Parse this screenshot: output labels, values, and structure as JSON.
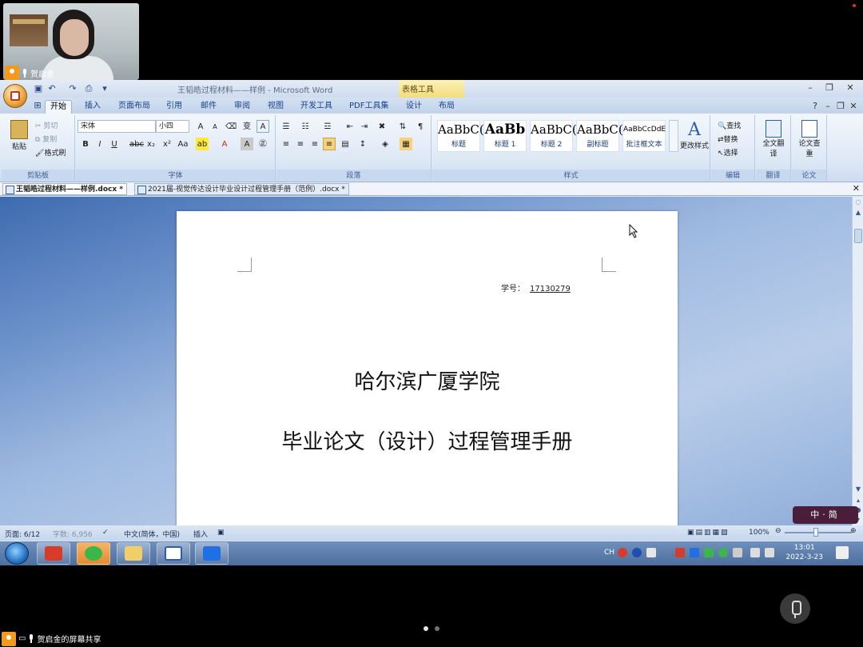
{
  "meeting": {
    "participant_name": "贺启金",
    "share_label": "贺启金的屏幕共享"
  },
  "window": {
    "title": "王韬皓过程材料——样例 - Microsoft Word",
    "context_tab": "表格工具"
  },
  "ribbon_tabs": [
    "开始",
    "插入",
    "页面布局",
    "引用",
    "邮件",
    "审阅",
    "视图",
    "开发工具",
    "PDF工具集",
    "设计",
    "布局"
  ],
  "ribbon": {
    "clipboard": {
      "paste": "粘贴",
      "cut": "剪切",
      "copy": "复制",
      "format_painter": "格式刷",
      "label": "剪贴板"
    },
    "font": {
      "name": "宋体",
      "size": "小四",
      "label": "字体"
    },
    "paragraph": {
      "label": "段落"
    },
    "styles": {
      "tiles": [
        {
          "sample": "AaBbC(",
          "name": "标题"
        },
        {
          "sample": "AaBb",
          "name": "标题 1"
        },
        {
          "sample": "AaBbC(",
          "name": "标题 2"
        },
        {
          "sample": "AaBbC(",
          "name": "副标题"
        },
        {
          "sample": "AaBbCcDdE",
          "name": "批注框文本"
        }
      ],
      "change_styles": "更改样式",
      "label": "样式"
    },
    "editing": {
      "find": "查找",
      "replace": "替换",
      "select": "选择",
      "label": "编辑"
    },
    "translate": {
      "button": "全文翻译",
      "label": "翻译"
    },
    "thesis": {
      "button": "论文查重",
      "label": "论文"
    }
  },
  "doc_tabs": [
    "王韬皓过程材料——样例.docx *",
    "2021届-视觉传达设计毕业设计过程管理手册（范例）.docx *"
  ],
  "document": {
    "student_no_label": "学号：",
    "student_no_value": "17130279",
    "school": "哈尔滨广厦学院",
    "handbook_title": "毕业论文（设计）过程管理手册"
  },
  "ime_label": "中·简",
  "status": {
    "page": "页面: 6/12",
    "words": "字数: 6,956",
    "language": "中文(简体，中国)",
    "mode": "插入",
    "zoom": "100%"
  },
  "taskbar": {
    "time": "13:01",
    "date": "2022-3-23",
    "lang": "CH"
  }
}
